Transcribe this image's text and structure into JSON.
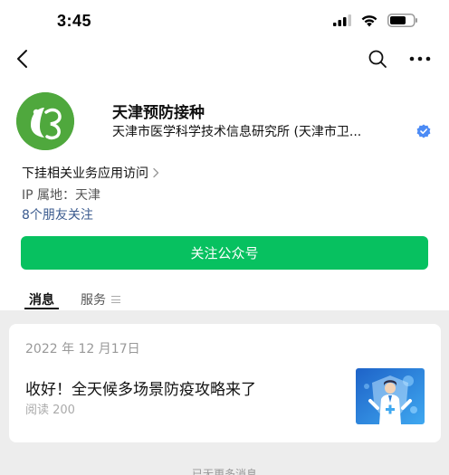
{
  "status_bar": {
    "time": "3:45"
  },
  "nav": {
    "back_icon": "chevron-left-icon",
    "search_icon": "search-icon",
    "more_icon": "more-icon"
  },
  "profile": {
    "name": "天津预防接种",
    "org": "天津市医学科学技术信息研究所 (天津市卫...",
    "related": "下挂相关业务应用访问",
    "ip_location": "IP 属地：天津",
    "friends": "8个朋友关注",
    "accent": "#07c160",
    "avatar_color": "#4fa83d"
  },
  "actions": {
    "follow_label": "关注公众号"
  },
  "tabs": [
    {
      "label": "消息"
    },
    {
      "label": "服务"
    }
  ],
  "feed": {
    "date": "2022 年 12 月17日",
    "article": {
      "title": "收好！全天候多场景防疫攻略来了",
      "reads": "阅读 200"
    },
    "more_label": "已无更多消息"
  }
}
